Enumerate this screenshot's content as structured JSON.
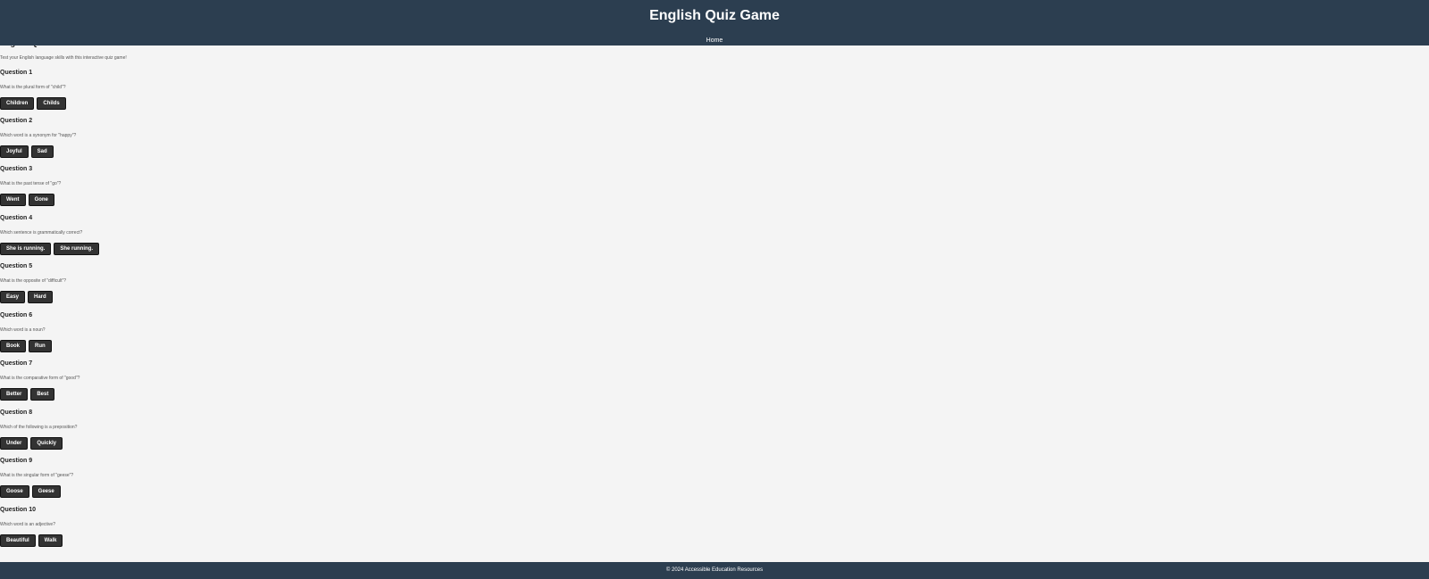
{
  "header": {
    "title": "English Quiz Game",
    "nav": [
      {
        "label": "Home"
      }
    ]
  },
  "main": {
    "heading": "English Quiz",
    "intro": "Test your English language skills with this interactive quiz game!",
    "questions": [
      {
        "title": "Question 1",
        "text": "What is the plural form of \"child\"?",
        "options": [
          "Children",
          "Childs"
        ]
      },
      {
        "title": "Question 2",
        "text": "Which word is a synonym for \"happy\"?",
        "options": [
          "Joyful",
          "Sad"
        ]
      },
      {
        "title": "Question 3",
        "text": "What is the past tense of \"go\"?",
        "options": [
          "Went",
          "Gone"
        ]
      },
      {
        "title": "Question 4",
        "text": "Which sentence is grammatically correct?",
        "options": [
          "She is running.",
          "She running."
        ]
      },
      {
        "title": "Question 5",
        "text": "What is the opposite of \"difficult\"?",
        "options": [
          "Easy",
          "Hard"
        ]
      },
      {
        "title": "Question 6",
        "text": "Which word is a noun?",
        "options": [
          "Book",
          "Run"
        ]
      },
      {
        "title": "Question 7",
        "text": "What is the comparative form of \"good\"?",
        "options": [
          "Better",
          "Best"
        ]
      },
      {
        "title": "Question 8",
        "text": "Which of the following is a preposition?",
        "options": [
          "Under",
          "Quickly"
        ]
      },
      {
        "title": "Question 9",
        "text": "What is the singular form of \"geese\"?",
        "options": [
          "Goose",
          "Geese"
        ]
      },
      {
        "title": "Question 10",
        "text": "Which word is an adjective?",
        "options": [
          "Beautiful",
          "Walk"
        ]
      }
    ]
  },
  "footer": {
    "copyright": "© 2024 Accessible Education Resources"
  },
  "colors": {
    "header_bg": "#2c3e50",
    "page_bg": "#f4f4f4",
    "button_bg": "#333333"
  }
}
